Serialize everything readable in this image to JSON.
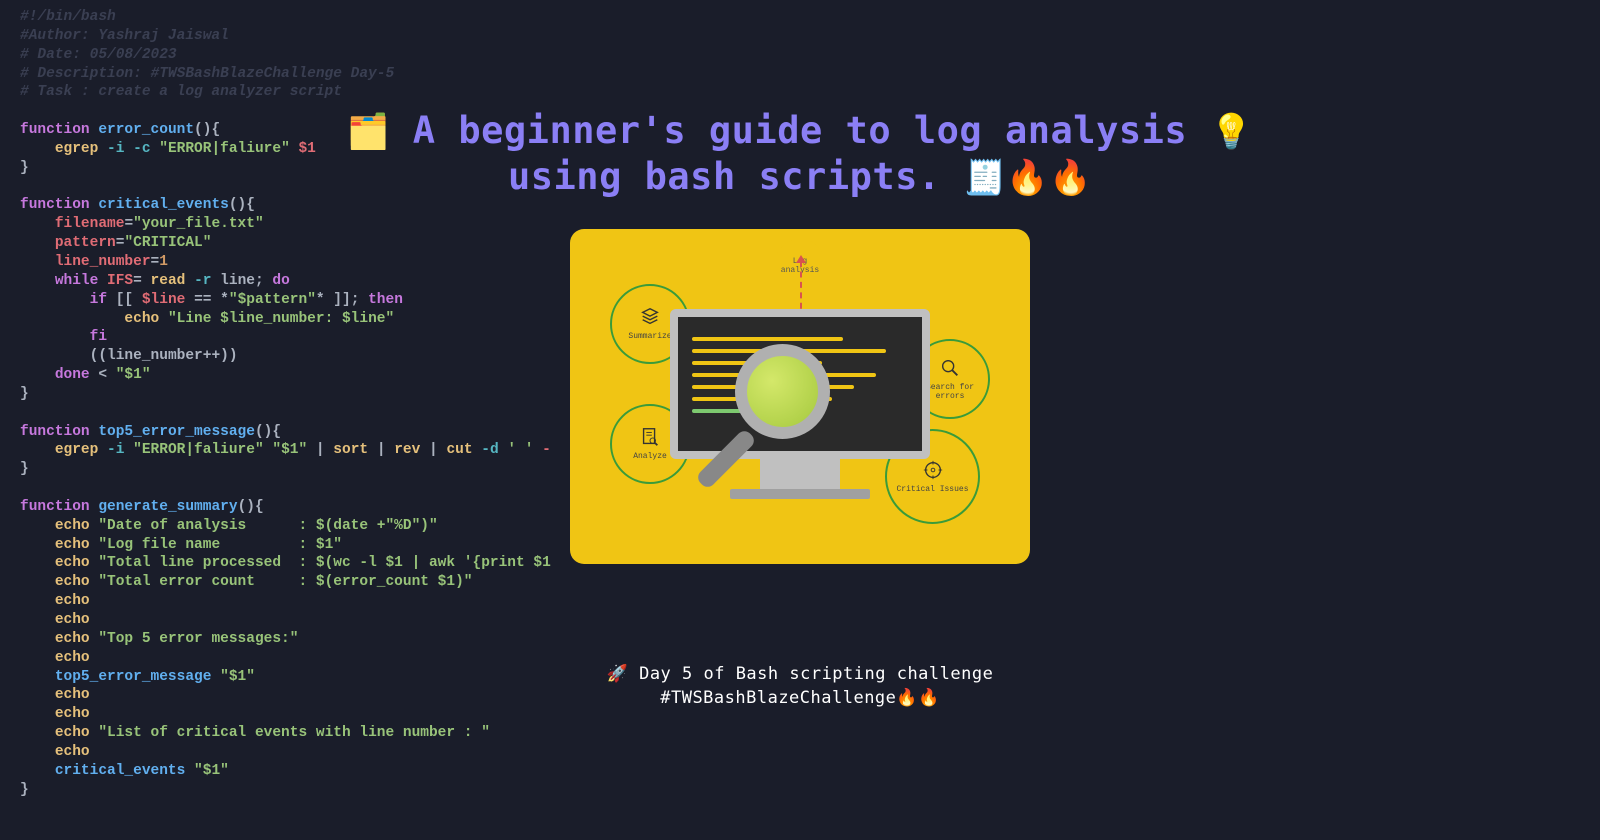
{
  "code": {
    "l1": "#!/bin/bash",
    "l2": "#Author: Yashraj Jaiswal",
    "l3": "# Date: 05/08/2023",
    "l4": "# Description: #TWSBashBlazeChallenge Day-5",
    "l5": "# Task : create a log analyzer script",
    "fn1": "error_count",
    "egrep_err": "\"ERROR|faliure\"",
    "fn2": "critical_events",
    "filename_val": "\"your_file.txt\"",
    "pattern_val": "\"CRITICAL\"",
    "linenum_val": "1",
    "echo_line": "\"Line $line_number: $line\"",
    "fn3": "top5_error_message",
    "fn4": "generate_summary",
    "date_str": "\"Date of analysis      : $(date +\"%D\")\"",
    "logfile_str": "\"Log file name         : $1\"",
    "total_line_str": "\"Total line processed  : $(wc -l $1 | awk '{print $1",
    "total_err_str": "\"Total error count     : $(error_count $1)\"",
    "top5_str": "\"Top 5 error messages:\"",
    "critlist_str": "\"List of critical events with line number : \""
  },
  "title": {
    "emoji_left": "🗂️",
    "line1": "A beginner's guide to log analysis",
    "emoji_bulb": "💡",
    "line2": "using bash scripts.",
    "emoji_receipt": "🧾",
    "emoji_fire": "🔥🔥"
  },
  "hero": {
    "top_label": "Log analysis",
    "summarize": "Summarize",
    "analyze": "Analyze",
    "search": "Search for errors",
    "critical": "Critical Issues"
  },
  "subtitle": {
    "emoji_rocket": "🚀",
    "line1": "Day 5 of Bash scripting challenge",
    "line2": "#TWSBashBlazeChallenge",
    "emoji_fire": "🔥🔥"
  }
}
